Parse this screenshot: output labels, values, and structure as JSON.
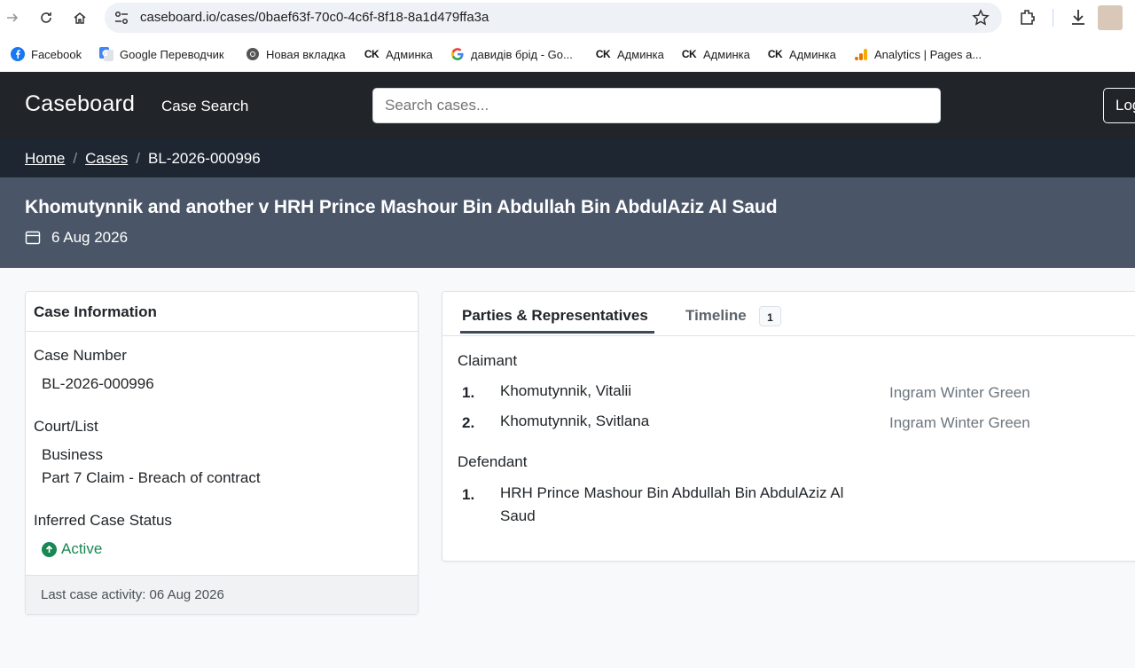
{
  "browser": {
    "url": "caseboard.io/cases/0baef63f-70c0-4c6f-8f18-8a1d479ffa3a",
    "bookmarks": [
      {
        "label": "Facebook",
        "icon": "facebook-icon"
      },
      {
        "label": "Google Переводчик",
        "icon": "google-translate-icon"
      },
      {
        "label": "Новая вкладка",
        "icon": "chrome-icon"
      },
      {
        "label": "Админка",
        "icon": "ck-icon"
      },
      {
        "label": "давидів брід - Go...",
        "icon": "google-icon"
      },
      {
        "label": "Админка",
        "icon": "ck-icon"
      },
      {
        "label": "Админка",
        "icon": "ck-icon"
      },
      {
        "label": "Админка",
        "icon": "ck-icon"
      },
      {
        "label": "Analytics | Pages a...",
        "icon": "analytics-icon"
      }
    ],
    "ck_glyph": "CK"
  },
  "navbar": {
    "brand": "Caseboard",
    "link": "Case Search",
    "search_placeholder": "Search cases...",
    "login_label": "Log"
  },
  "breadcrumb": {
    "home": "Home",
    "cases": "Cases",
    "current": "BL-2026-000996",
    "separator": "/"
  },
  "case": {
    "title": "Khomutynnik and another v HRH Prince Mashour Bin Abdullah Bin AbdulAziz Al Saud",
    "date": "6 Aug 2026"
  },
  "info_card": {
    "header": "Case Information",
    "case_number_label": "Case Number",
    "case_number": "BL-2026-000996",
    "court_label": "Court/List",
    "court": "Business",
    "list": "Part 7 Claim - Breach of contract",
    "status_label": "Inferred Case Status",
    "status": "Active",
    "status_color": "#198754",
    "footer": "Last case activity: 06 Aug 2026"
  },
  "parties_card": {
    "tab_parties": "Parties & Representatives",
    "tab_timeline": "Timeline",
    "timeline_count": "1",
    "claimant_title": "Claimant",
    "claimants": [
      {
        "num": "1.",
        "name": "Khomutynnik, Vitalii",
        "rep": "Ingram Winter Green"
      },
      {
        "num": "2.",
        "name": "Khomutynnik, Svitlana",
        "rep": "Ingram Winter Green"
      }
    ],
    "defendant_title": "Defendant",
    "defendants": [
      {
        "num": "1.",
        "name": "HRH Prince Mashour Bin Abdullah Bin AbdulAziz Al Saud"
      }
    ]
  }
}
